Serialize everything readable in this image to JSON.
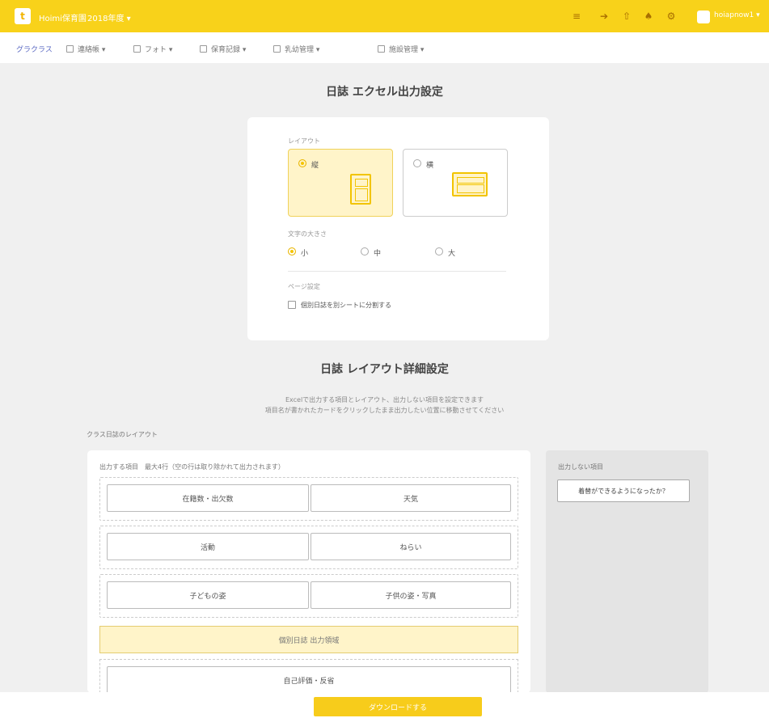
{
  "topbar": {
    "logo_glyph": "t",
    "brand": "Hoimi保育園",
    "year": "2018年度",
    "year_caret": "▾",
    "icons": [
      "list-icon",
      "send-icon",
      "upload-icon",
      "bell-icon",
      "gear-icon"
    ],
    "user": "hoiapnow1",
    "user_caret": "▾",
    "accent": "#f8d21a"
  },
  "subnav": {
    "items": [
      {
        "label": "グラクラス"
      },
      {
        "label": "連絡帳",
        "caret": "▾"
      },
      {
        "label": "フォト",
        "caret": "▾"
      },
      {
        "label": "保育記録",
        "caret": "▾"
      },
      {
        "label": "乳幼管理",
        "caret": "▾"
      },
      {
        "label": "施設管理",
        "caret": "▾"
      }
    ]
  },
  "excel_settings": {
    "title": "日誌 エクセル出力設定",
    "layout_label": "レイアウト",
    "layout_options": [
      {
        "label": "縦",
        "selected": true
      },
      {
        "label": "横",
        "selected": false
      }
    ],
    "font_size_label": "文字の大きさ",
    "font_sizes": [
      {
        "label": "小",
        "selected": true
      },
      {
        "label": "中",
        "selected": false
      },
      {
        "label": "大",
        "selected": false
      }
    ],
    "page_break_label": "ページ設定",
    "page_break_option": "個別日誌を別シートに分割する"
  },
  "layout_detail": {
    "title": "日誌 レイアウト詳細設定",
    "desc_line1": "Excelで出力する項目とレイアウト、出力しない項目を設定できます",
    "desc_line2": "項目名が書かれたカードをクリックしたまま出力したい位置に移動させてください",
    "class_layout_label": "クラス日誌のレイアウト",
    "output_label": "出力する項目　最大4行（空の行は取り除かれて出力されます）",
    "rows": [
      [
        "在籍数・出欠数",
        "天気"
      ],
      [
        "活動",
        "ねらい"
      ],
      [
        "子どもの姿",
        "子供の姿・写真"
      ]
    ],
    "highlight_row": "個別日誌 出力領域",
    "partial_row": "自己評価・反省",
    "hidden_label": "出力しない項目",
    "hidden_items": [
      "着替ができるようになったか？"
    ]
  },
  "download_label": "ダウンロードする"
}
